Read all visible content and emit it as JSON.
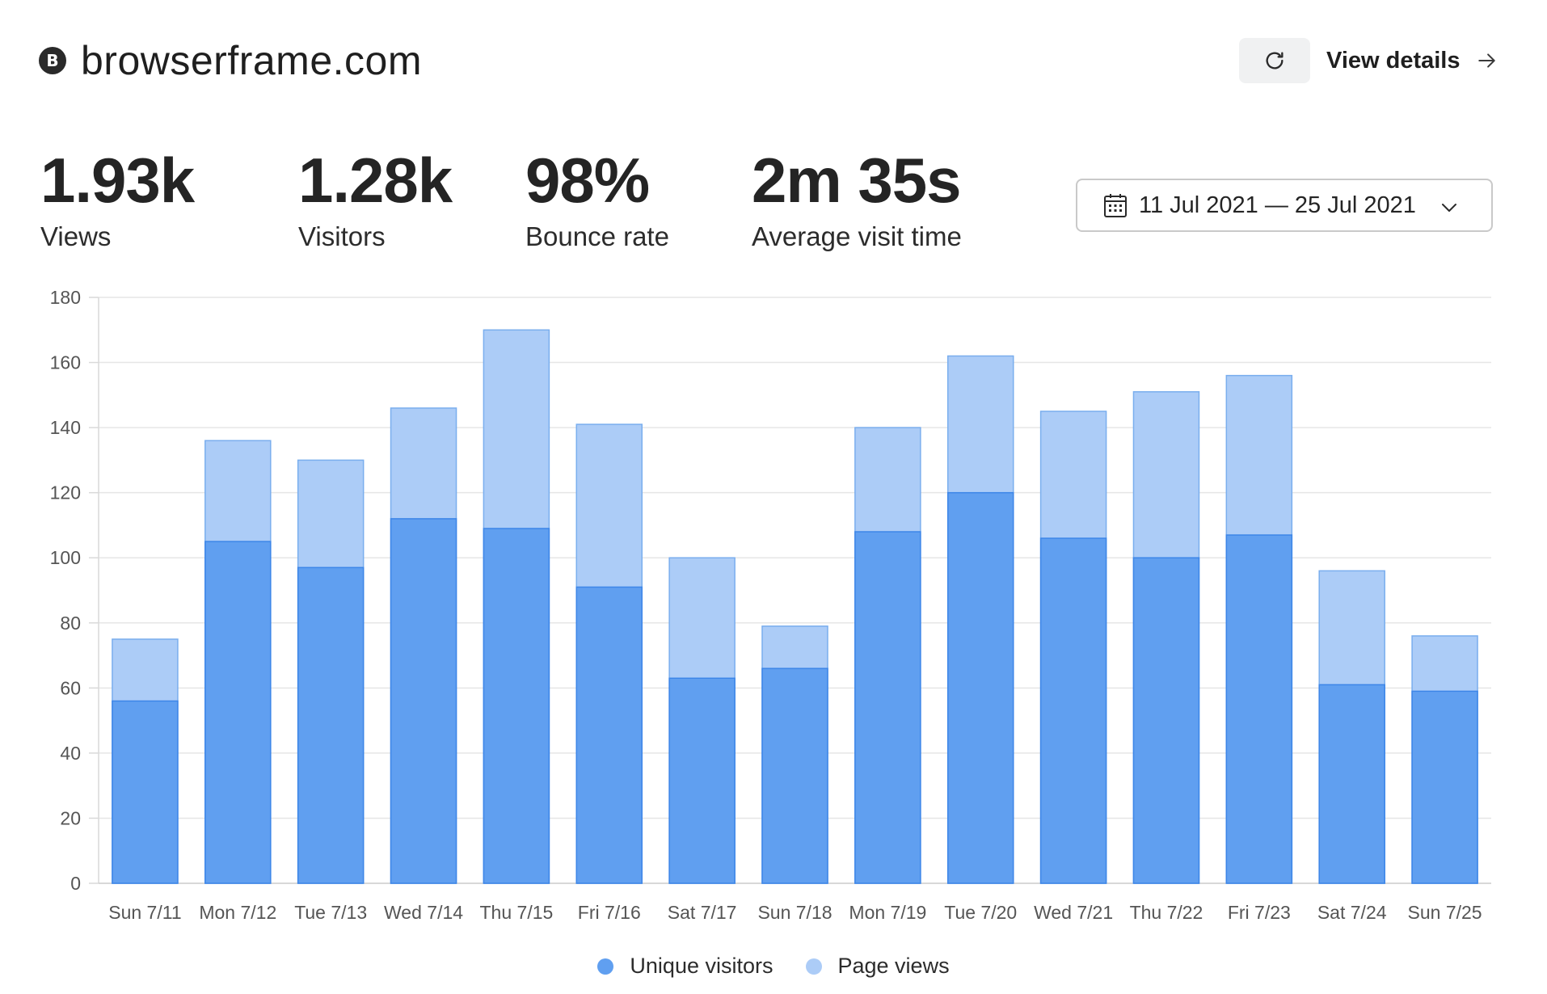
{
  "site": {
    "favicon_letter": "B",
    "name": "browserframe.com"
  },
  "toolbar": {
    "refresh_icon": "refresh-icon",
    "view_details_label": "View details",
    "arrow_icon": "arrow-right-icon"
  },
  "metrics": [
    {
      "value": "1.93k",
      "label": "Views"
    },
    {
      "value": "1.28k",
      "label": "Visitors"
    },
    {
      "value": "98%",
      "label": "Bounce rate"
    },
    {
      "value": "2m 35s",
      "label": "Average visit time"
    }
  ],
  "date_range": {
    "label": "11 Jul 2021 — 25 Jul 2021",
    "icon": "calendar-icon",
    "dropdown_icon": "chevron-down-icon"
  },
  "colors": {
    "unique": "#609ff0",
    "unique_border": "#3d86e8",
    "pageviews": "#acccf7",
    "pageviews_border": "#7aaeee",
    "grid": "#e6e6e6"
  },
  "chart_data": {
    "type": "bar",
    "stacked": true,
    "categories": [
      "Sun 7/11",
      "Mon 7/12",
      "Tue 7/13",
      "Wed 7/14",
      "Thu 7/15",
      "Fri 7/16",
      "Sat 7/17",
      "Sun 7/18",
      "Mon 7/19",
      "Tue 7/20",
      "Wed 7/21",
      "Thu 7/22",
      "Fri 7/23",
      "Sat 7/24",
      "Sun 7/25"
    ],
    "series": [
      {
        "name": "Unique visitors",
        "values": [
          56,
          105,
          97,
          112,
          109,
          91,
          63,
          66,
          108,
          120,
          106,
          100,
          107,
          61,
          59
        ]
      },
      {
        "name": "Page views",
        "values": [
          75,
          136,
          130,
          146,
          170,
          141,
          100,
          79,
          140,
          162,
          145,
          151,
          156,
          96,
          76
        ]
      }
    ],
    "ylim": [
      0,
      180
    ],
    "yticks": [
      0,
      20,
      40,
      60,
      80,
      100,
      120,
      140,
      160,
      180
    ],
    "grid": true,
    "legend_position": "bottom"
  }
}
